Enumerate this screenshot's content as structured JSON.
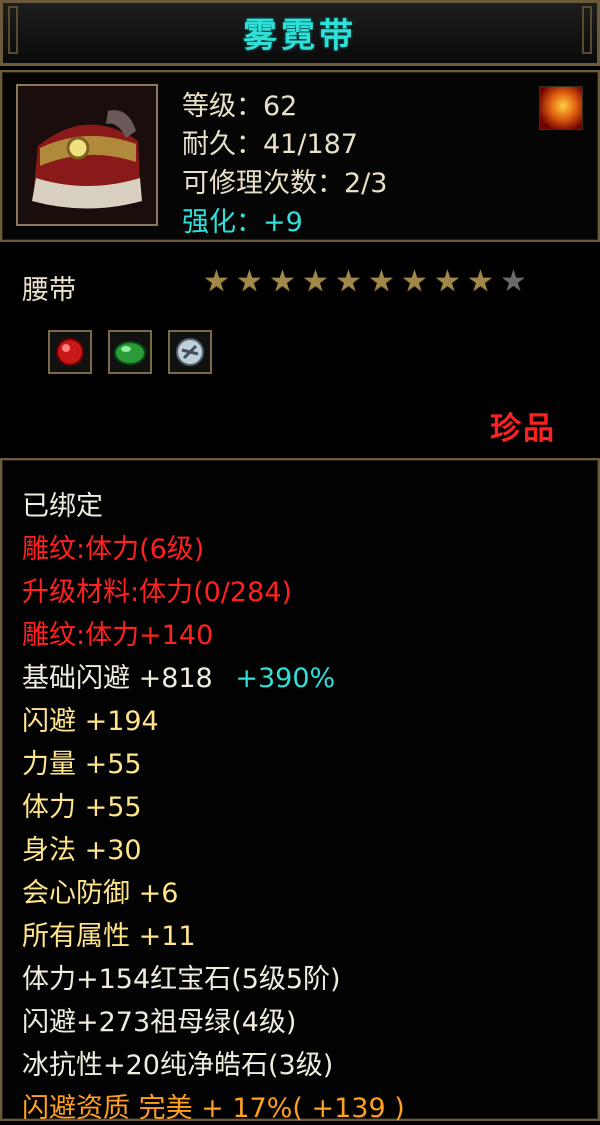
{
  "item": {
    "name": "雾霓带",
    "level_line": "等级：62",
    "durability_line": "耐久：41/187",
    "repair_line": "可修理次数：2/3",
    "enhance_line": "强化：+9",
    "type": "腰带",
    "stars_total": 10,
    "stars_filled": 9,
    "rarity": "珍品"
  },
  "gems": [
    {
      "icon": "ruby-gem-icon",
      "color": "#d01818"
    },
    {
      "icon": "emerald-gem-icon",
      "color": "#2a9a3a"
    },
    {
      "icon": "diamond-gem-icon",
      "color": "#c8d8e0"
    }
  ],
  "attributes": {
    "bound": "已绑定",
    "engrave1": "雕纹:体力(6级)",
    "upgrade_material": "升级材料:体力(0/284)",
    "engrave2": "雕纹:体力+140",
    "base_dodge": "基础闪避 +818",
    "base_dodge_pct": "+390%",
    "dodge": "闪避 +194",
    "strength": "力量 +55",
    "stamina": "体力 +55",
    "agility": "身法 +30",
    "crit_def": "会心防御 +6",
    "all_attr": "所有属性 +11",
    "gem1": "体力+154红宝石(5级5阶)",
    "gem2": "闪避+273祖母绿(4级)",
    "gem3": "冰抗性+20纯净皓石(3级)",
    "quality": "闪避资质 完美 + 17%( +139 )"
  },
  "colors": {
    "title": "#2fe0d8",
    "rarity": "#ff2020",
    "stat_yellow": "#ffe48a",
    "quality_orange": "#ffa020"
  }
}
